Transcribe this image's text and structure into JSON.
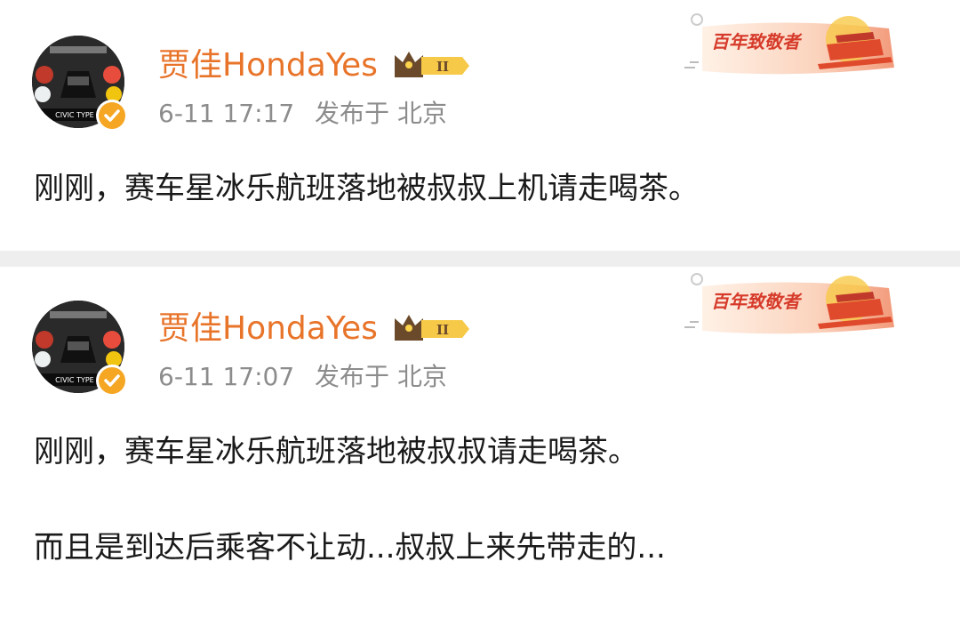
{
  "posts": [
    {
      "username": "贾佳HondaYes",
      "time": "6-11 17:17",
      "location": "发布于 北京",
      "badge_text": "百年致敬者",
      "vip_level": "II",
      "content_lines": [
        "刚刚，赛车星冰乐航班落地被叔叔上机请走喝茶。"
      ]
    },
    {
      "username": "贾佳HondaYes",
      "time": "6-11 17:07",
      "location": "发布于 北京",
      "badge_text": "百年致敬者",
      "vip_level": "II",
      "content_lines": [
        "刚刚，赛车星冰乐航班落地被叔叔请走喝茶。",
        "而且是到达后乘客不让动...叔叔上来先带走的..."
      ]
    }
  ],
  "avatar_caption": "CIVIC TYPE R",
  "colors": {
    "username": "#e8742a",
    "meta": "#8c8c8c",
    "text": "#1a1a1a",
    "separator": "#eeeeee",
    "verified": "#f5a623",
    "badge_red": "#e04a2c"
  },
  "icons": {
    "verified": "verified-check-icon",
    "vip": "crown-icon",
    "event": "centennial-badge-icon"
  }
}
